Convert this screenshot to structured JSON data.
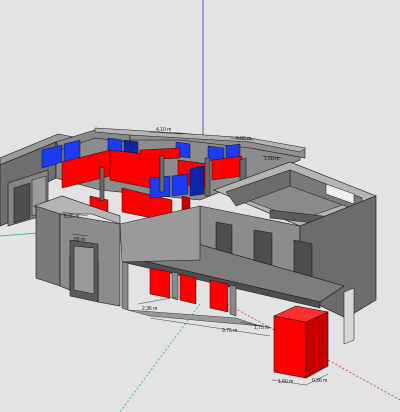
{
  "viewport": {
    "background": "#e3e3e3",
    "description_role": "3D modeling viewport"
  },
  "axes": {
    "red_axis_color": "#c0392b",
    "green_axis_color": "#27ae60",
    "blue_axis_color": "#2c3ea8"
  },
  "materials": {
    "wall_gray": "#7d7d7d",
    "wall_gray_dark": "#5c5c5c",
    "wall_gray_light": "#9a9a9a",
    "wall_top": "#b4b4b4",
    "red_fill": "#ff0000",
    "red_dark": "#c80000",
    "blue_fill": "#1b3cf2",
    "blue_dark": "#0f24a8",
    "edge_color": "#111111"
  },
  "dimensions": [
    {
      "id": "dim-top-1",
      "text": "4,10 m"
    },
    {
      "id": "dim-top-2",
      "text": "0,00 m"
    },
    {
      "id": "dim-top-3",
      "text": "1,60 m"
    },
    {
      "id": "dim-left-1",
      "text": "5,90 m"
    },
    {
      "id": "dim-left-2",
      "text": "55 m"
    },
    {
      "id": "dim-bottom-1",
      "text": "2,36 m"
    },
    {
      "id": "dim-bottom-2",
      "text": "9,75 m"
    },
    {
      "id": "dim-bottom-3",
      "text": "1,75 m"
    },
    {
      "id": "dim-bottom-4",
      "text": "1,60 m"
    },
    {
      "id": "dim-bottom-5",
      "text": "0,36 m"
    }
  ]
}
